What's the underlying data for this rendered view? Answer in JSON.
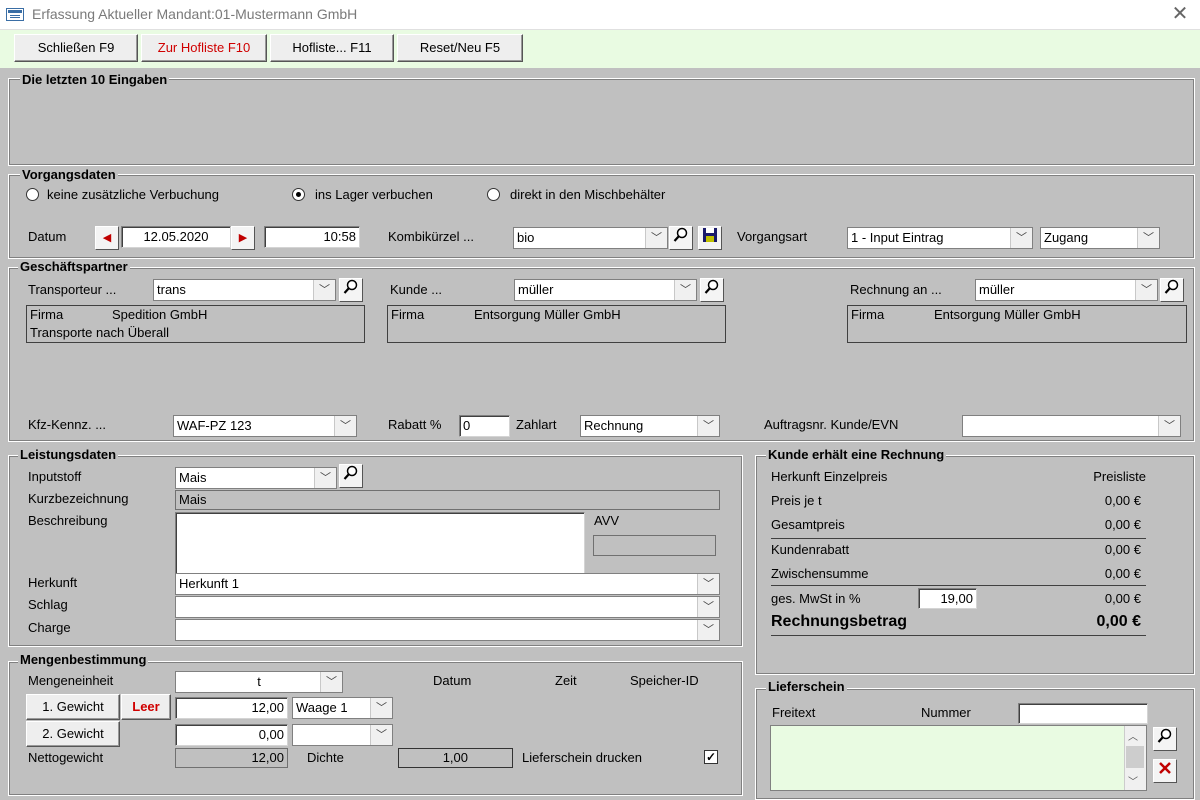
{
  "window": {
    "title": "Erfassung Aktueller Mandant:01-Mustermann GmbH"
  },
  "toolbar": {
    "close": "Schließen F9",
    "hofliste_to": "Zur Hofliste F10",
    "hofliste": "Hofliste... F11",
    "reset": "Reset/Neu F5"
  },
  "recent": {
    "title": "Die letzten 10 Eingaben"
  },
  "vorgang": {
    "title": "Vorgangsdaten",
    "radios": [
      "keine zusätzliche Verbuchung",
      "ins Lager verbuchen",
      "direkt in den Mischbehälter"
    ],
    "selected": "ins Lager verbuchen",
    "datum_label": "Datum",
    "datum": "12.05.2020",
    "zeit": "10:58",
    "kombi_label": "Kombikürzel ...",
    "kombi": "bio",
    "vorgangsart_label": "Vorgangsart",
    "vorgangsart": "1 - Input Eintrag",
    "zugang": "Zugang"
  },
  "partner": {
    "title": "Geschäftspartner",
    "transporteur_label": "Transporteur ...",
    "transporteur": "trans",
    "transporteur_firma_label": "Firma",
    "transporteur_firma": "Spedition GmbH",
    "transporteur_line2": "Transporte nach Überall",
    "kunde_label": "Kunde ...",
    "kunde": "müller",
    "kunde_firma_label": "Firma",
    "kunde_firma": "Entsorgung Müller GmbH",
    "rechnung_label": "Rechnung an ...",
    "rechnung": "müller",
    "rechnung_firma_label": "Firma",
    "rechnung_firma": "Entsorgung Müller GmbH",
    "kfz_label": "Kfz-Kennz. ...",
    "kfz": "WAF-PZ 123",
    "rabatt_label": "Rabatt %",
    "rabatt": "0",
    "zahlart_label": "Zahlart",
    "zahlart": "Rechnung",
    "auftrag_label": "Auftragsnr. Kunde/EVN",
    "auftrag": ""
  },
  "leistung": {
    "title": "Leistungsdaten",
    "inputstoff_label": "Inputstoff",
    "inputstoff": "Mais",
    "kurz_label": "Kurzbezeichnung",
    "kurz": "Mais",
    "beschr_label": "Beschreibung",
    "avv_label": "AVV",
    "herkunft_label": "Herkunft",
    "herkunft": "Herkunft 1",
    "schlag_label": "Schlag",
    "charge_label": "Charge"
  },
  "menge": {
    "title": "Mengenbestimmung",
    "einheit_label": "Mengeneinheit",
    "einheit": "t",
    "datum_col": "Datum",
    "zeit_col": "Zeit",
    "speicher_col": "Speicher-ID",
    "gewicht1_btn": "1. Gewicht",
    "leer_btn": "Leer",
    "gewicht1": "12,00",
    "waage": "Waage 1",
    "gewicht2_btn": "2. Gewicht",
    "gewicht2": "0,00",
    "netto_label": "Nettogewicht",
    "netto": "12,00",
    "dichte_label": "Dichte",
    "dichte": "1,00",
    "druck_label": "Lieferschein drucken",
    "druck_checked": true
  },
  "rechnung": {
    "title": "Kunde erhält eine Rechnung",
    "herkunft_label": "Herkunft Einzelpreis",
    "herkunft_val": "Preisliste",
    "preis_label": "Preis je t",
    "preis": "0,00 €",
    "gesamt_label": "Gesamtpreis",
    "gesamt": "0,00 €",
    "rabatt_label": "Kundenrabatt",
    "rabatt": "0,00 €",
    "zwischen_label": "Zwischensumme",
    "zwischen": "0,00 €",
    "mwst_label": "ges. MwSt in %",
    "mwst_pct": "19,00",
    "mwst": "0,00 €",
    "betrag_label": "Rechnungsbetrag",
    "betrag": "0,00 €"
  },
  "lieferschein": {
    "title": "Lieferschein",
    "freitext_label": "Freitext",
    "nummer_label": "Nummer",
    "nummer": ""
  },
  "colors": {
    "toolbar_bg": "#e9fbe2",
    "accent_red": "#d00000",
    "lieferschein_text_bg": "#e9fbe2"
  }
}
